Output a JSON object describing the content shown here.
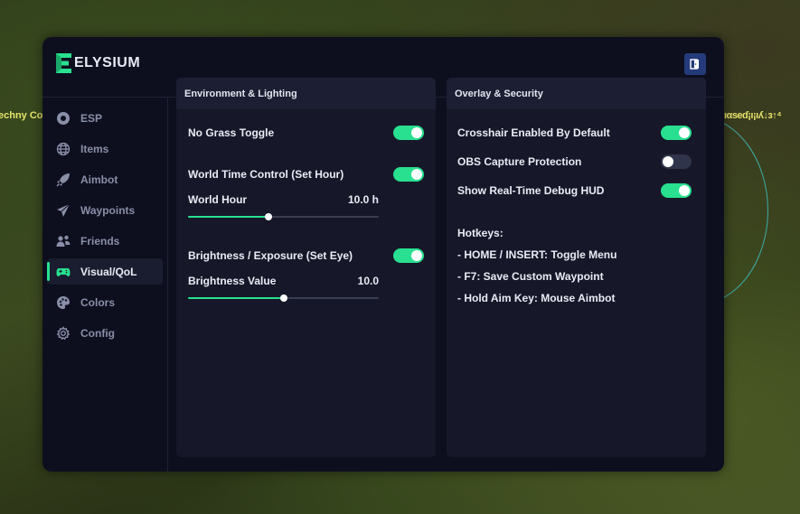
{
  "background": {
    "left_text": "echny Co",
    "right_text": "ıαѕеɗ¡ı¡ıʎ↓з↑⁴"
  },
  "app": {
    "title": "ELYSIUM",
    "logo_letter": "E",
    "accent_color": "#28e08f",
    "exit_icon": "exit-door-icon"
  },
  "sidebar": {
    "items": [
      {
        "label": "ESP",
        "icon": "eye-icon",
        "active": false
      },
      {
        "label": "Items",
        "icon": "globe-icon",
        "active": false
      },
      {
        "label": "Aimbot",
        "icon": "rocket-icon",
        "active": false
      },
      {
        "label": "Waypoints",
        "icon": "paper-plane-icon",
        "active": false
      },
      {
        "label": "Friends",
        "icon": "users-icon",
        "active": false
      },
      {
        "label": "Visual/QoL",
        "icon": "gamepad-icon",
        "active": true
      },
      {
        "label": "Colors",
        "icon": "palette-icon",
        "active": false
      },
      {
        "label": "Config",
        "icon": "gear-icon",
        "active": false
      }
    ]
  },
  "env_panel": {
    "title": "Environment & Lighting",
    "no_grass": {
      "label": "No Grass Toggle",
      "on": true
    },
    "world_time": {
      "label": "World Time Control (Set Hour)",
      "on": true
    },
    "world_hour": {
      "label": "World Hour",
      "value": "10.0 h",
      "fraction": 0.42
    },
    "brightness": {
      "label": "Brightness / Exposure (Set Eye)",
      "on": true
    },
    "brightness_value": {
      "label": "Brightness Value",
      "value": "10.0",
      "fraction": 0.5
    }
  },
  "overlay_panel": {
    "title": "Overlay & Security",
    "crosshair": {
      "label": "Crosshair Enabled By Default",
      "on": true
    },
    "obs": {
      "label": "OBS Capture Protection",
      "on": false
    },
    "debug_hud": {
      "label": "Show Real-Time Debug HUD",
      "on": true
    },
    "hotkeys_title": "Hotkeys:",
    "hotkeys": [
      "- HOME / INSERT: Toggle Menu",
      "- F7: Save Custom Waypoint",
      "- Hold Aim Key: Mouse Aimbot"
    ]
  }
}
